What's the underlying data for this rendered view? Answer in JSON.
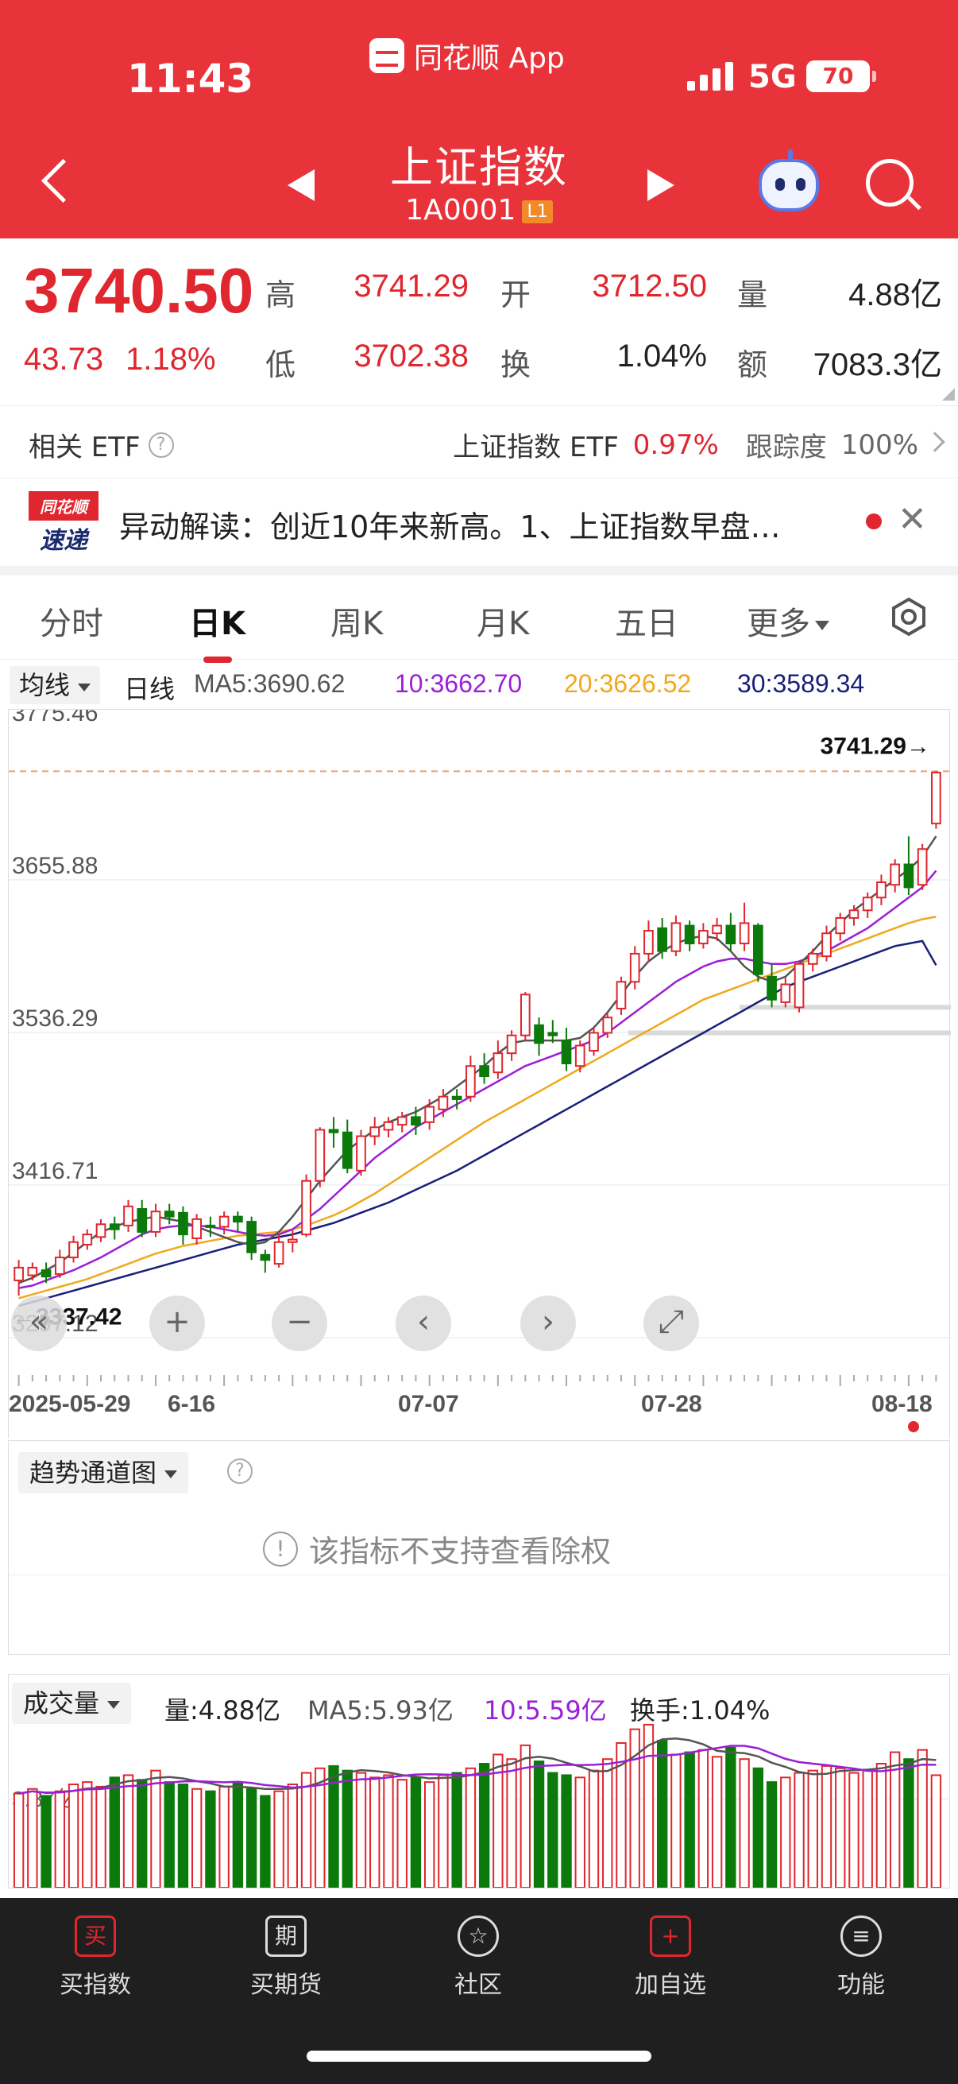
{
  "status": {
    "time": "11:43",
    "app_name": "同花顺 App",
    "network": "5G",
    "battery": "70"
  },
  "header": {
    "title": "上证指数",
    "code": "1A0001",
    "level_badge": "L1"
  },
  "quote": {
    "price": "3740.50",
    "change": "43.73",
    "change_pct": "1.18%",
    "high_label": "高",
    "high": "3741.29",
    "low_label": "低",
    "low": "3702.38",
    "open_label": "开",
    "open": "3712.50",
    "turnover_label": "换",
    "turnover": "1.04%",
    "volume_label": "量",
    "volume": "4.88亿",
    "amount_label": "额",
    "amount": "7083.3亿"
  },
  "etf": {
    "label": "相关 ETF",
    "name": "上证指数 ETF",
    "pct": "0.97%",
    "track_label": "跟踪度",
    "track": "100%"
  },
  "news": {
    "badge_top": "同花顺",
    "badge_bottom": "速递",
    "text": "异动解读：创近10年来新高。1、上证指数早盘…"
  },
  "tabs": [
    "分时",
    "日K",
    "周K",
    "月K",
    "五日",
    "更多"
  ],
  "ma": {
    "selector": "均线",
    "period": "日线",
    "ma5": "MA5:3690.62",
    "ma10": "10:3662.70",
    "ma20": "20:3626.52",
    "ma30": "30:3589.34",
    "colors": {
      "ma5": "#555555",
      "ma10": "#9b1fd6",
      "ma20": "#f0a81c",
      "ma30": "#1a1f7a"
    }
  },
  "chart_data": {
    "type": "candlestick",
    "y_labels": [
      "3775.46",
      "3655.88",
      "3536.29",
      "3416.71",
      "3297.12"
    ],
    "ylim": [
      3297.12,
      3775.46
    ],
    "high_marker": "3741.29→",
    "low_marker": "←3337.42",
    "x_labels": [
      "2025-05-29",
      "6-16",
      "07-07",
      "07-28",
      "08-18"
    ],
    "candles": [
      [
        3342,
        3352,
        3330,
        3358
      ],
      [
        3346,
        3352,
        3342,
        3356
      ],
      [
        3350,
        3345,
        3340,
        3356
      ],
      [
        3347,
        3360,
        3344,
        3366
      ],
      [
        3360,
        3372,
        3356,
        3377
      ],
      [
        3370,
        3378,
        3366,
        3382
      ],
      [
        3376,
        3386,
        3372,
        3390
      ],
      [
        3386,
        3382,
        3374,
        3392
      ],
      [
        3385,
        3400,
        3380,
        3405
      ],
      [
        3398,
        3380,
        3376,
        3405
      ],
      [
        3380,
        3396,
        3376,
        3402
      ],
      [
        3396,
        3392,
        3386,
        3402
      ],
      [
        3395,
        3378,
        3370,
        3400
      ],
      [
        3375,
        3390,
        3370,
        3394
      ],
      [
        3385,
        3384,
        3376,
        3392
      ],
      [
        3384,
        3392,
        3378,
        3396
      ],
      [
        3392,
        3388,
        3380,
        3396
      ],
      [
        3388,
        3364,
        3358,
        3392
      ],
      [
        3362,
        3358,
        3348,
        3366
      ],
      [
        3355,
        3372,
        3352,
        3378
      ],
      [
        3372,
        3374,
        3364,
        3382
      ],
      [
        3378,
        3420,
        3376,
        3425
      ],
      [
        3420,
        3460,
        3415,
        3462
      ],
      [
        3460,
        3458,
        3446,
        3470
      ],
      [
        3458,
        3430,
        3426,
        3468
      ],
      [
        3428,
        3455,
        3424,
        3460
      ],
      [
        3455,
        3462,
        3448,
        3470
      ],
      [
        3460,
        3466,
        3454,
        3470
      ],
      [
        3464,
        3470,
        3458,
        3474
      ],
      [
        3470,
        3464,
        3456,
        3478
      ],
      [
        3466,
        3478,
        3460,
        3484
      ],
      [
        3476,
        3486,
        3470,
        3492
      ],
      [
        3486,
        3484,
        3476,
        3492
      ],
      [
        3486,
        3510,
        3482,
        3518
      ],
      [
        3510,
        3502,
        3496,
        3520
      ],
      [
        3505,
        3520,
        3500,
        3530
      ],
      [
        3520,
        3534,
        3514,
        3538
      ],
      [
        3534,
        3566,
        3530,
        3568
      ],
      [
        3542,
        3528,
        3518,
        3548
      ],
      [
        3536,
        3534,
        3528,
        3546
      ],
      [
        3530,
        3512,
        3506,
        3540
      ],
      [
        3510,
        3526,
        3505,
        3530
      ],
      [
        3522,
        3536,
        3518,
        3540
      ],
      [
        3536,
        3548,
        3532,
        3552
      ],
      [
        3555,
        3576,
        3550,
        3580
      ],
      [
        3576,
        3598,
        3570,
        3604
      ],
      [
        3598,
        3616,
        3592,
        3624
      ],
      [
        3618,
        3600,
        3594,
        3626
      ],
      [
        3600,
        3622,
        3596,
        3628
      ],
      [
        3620,
        3606,
        3600,
        3624
      ],
      [
        3606,
        3616,
        3602,
        3622
      ],
      [
        3614,
        3620,
        3608,
        3626
      ],
      [
        3620,
        3606,
        3600,
        3630
      ],
      [
        3606,
        3622,
        3600,
        3638
      ],
      [
        3620,
        3582,
        3576,
        3622
      ],
      [
        3580,
        3562,
        3556,
        3590
      ],
      [
        3560,
        3574,
        3556,
        3580
      ],
      [
        3556,
        3590,
        3552,
        3592
      ],
      [
        3590,
        3598,
        3584,
        3602
      ],
      [
        3596,
        3614,
        3592,
        3620
      ],
      [
        3614,
        3626,
        3608,
        3630
      ],
      [
        3626,
        3632,
        3620,
        3636
      ],
      [
        3632,
        3642,
        3626,
        3646
      ],
      [
        3642,
        3654,
        3636,
        3660
      ],
      [
        3652,
        3668,
        3646,
        3672
      ],
      [
        3668,
        3650,
        3644,
        3690
      ],
      [
        3652,
        3680,
        3648,
        3684
      ],
      [
        3700,
        3740,
        3696,
        3741
      ]
    ],
    "ma5": [
      3340,
      3344,
      3350,
      3356,
      3364,
      3372,
      3380,
      3384,
      3388,
      3390,
      3392,
      3390,
      3388,
      3384,
      3380,
      3376,
      3372,
      3370,
      3372,
      3380,
      3392,
      3406,
      3420,
      3432,
      3444,
      3452,
      3460,
      3466,
      3470,
      3474,
      3480,
      3486,
      3494,
      3502,
      3510,
      3520,
      3528,
      3530,
      3530,
      3530,
      3530,
      3532,
      3540,
      3552,
      3566,
      3580,
      3592,
      3600,
      3606,
      3610,
      3612,
      3610,
      3600,
      3588,
      3580,
      3576,
      3580,
      3590,
      3600,
      3612,
      3622,
      3632,
      3640,
      3648,
      3656,
      3664,
      3674,
      3690
    ],
    "ma10": [
      3336,
      3338,
      3342,
      3346,
      3350,
      3355,
      3360,
      3366,
      3372,
      3378,
      3382,
      3384,
      3385,
      3385,
      3384,
      3382,
      3380,
      3378,
      3377,
      3378,
      3382,
      3390,
      3398,
      3408,
      3418,
      3428,
      3438,
      3446,
      3454,
      3462,
      3468,
      3474,
      3480,
      3486,
      3492,
      3498,
      3504,
      3510,
      3514,
      3518,
      3522,
      3526,
      3530,
      3536,
      3544,
      3552,
      3560,
      3568,
      3576,
      3582,
      3588,
      3592,
      3594,
      3594,
      3592,
      3590,
      3590,
      3592,
      3596,
      3600,
      3606,
      3612,
      3618,
      3626,
      3634,
      3642,
      3650,
      3663
    ],
    "ma20": [
      3328,
      3331,
      3334,
      3337,
      3340,
      3343,
      3347,
      3351,
      3355,
      3359,
      3363,
      3366,
      3369,
      3371,
      3373,
      3375,
      3377,
      3378,
      3379,
      3380,
      3382,
      3385,
      3389,
      3393,
      3398,
      3404,
      3410,
      3417,
      3424,
      3431,
      3438,
      3445,
      3452,
      3459,
      3466,
      3472,
      3478,
      3484,
      3490,
      3496,
      3502,
      3508,
      3514,
      3520,
      3526,
      3532,
      3538,
      3544,
      3550,
      3556,
      3562,
      3566,
      3570,
      3574,
      3578,
      3582,
      3586,
      3590,
      3594,
      3598,
      3602,
      3606,
      3610,
      3614,
      3618,
      3622,
      3625,
      3627
    ],
    "ma30": [
      3322,
      3325,
      3328,
      3331,
      3334,
      3337,
      3340,
      3343,
      3346,
      3349,
      3352,
      3355,
      3358,
      3361,
      3364,
      3367,
      3370,
      3372,
      3374,
      3376,
      3378,
      3381,
      3384,
      3387,
      3391,
      3395,
      3399,
      3403,
      3408,
      3413,
      3418,
      3423,
      3428,
      3434,
      3440,
      3446,
      3452,
      3458,
      3464,
      3470,
      3476,
      3482,
      3488,
      3494,
      3500,
      3506,
      3512,
      3518,
      3524,
      3530,
      3536,
      3542,
      3548,
      3554,
      3560,
      3566,
      3572,
      3576,
      3580,
      3584,
      3588,
      3592,
      3596,
      3600,
      3604,
      3606,
      3608,
      3589
    ]
  },
  "controls": [
    "«",
    "+",
    "−",
    "‹",
    "›",
    "⤢"
  ],
  "trend": {
    "selector": "趋势通道图",
    "message": "该指标不支持查看除权"
  },
  "volume": {
    "selector": "成交量",
    "vol": "量:4.88亿",
    "ma5": "MA5:5.93亿",
    "ma10": "10:5.59亿",
    "turnover": "换手:1.04%",
    "axis_label": "3.87亿",
    "bars": [
      4.1,
      4.3,
      4.0,
      4.2,
      4.5,
      4.6,
      4.4,
      4.8,
      4.9,
      4.7,
      5.1,
      4.6,
      4.5,
      4.3,
      4.2,
      4.4,
      4.6,
      4.3,
      4.0,
      4.2,
      4.5,
      5.0,
      5.2,
      5.3,
      5.1,
      5.0,
      4.8,
      4.9,
      4.7,
      4.8,
      4.6,
      4.9,
      5.0,
      5.2,
      5.4,
      5.8,
      5.6,
      6.2,
      5.5,
      5.0,
      4.9,
      4.8,
      5.1,
      5.6,
      6.3,
      6.9,
      7.1,
      6.4,
      5.8,
      5.9,
      6.0,
      5.7,
      6.1,
      5.6,
      5.2,
      4.6,
      4.8,
      5.0,
      5.1,
      5.3,
      5.2,
      5.0,
      5.1,
      5.4,
      5.9,
      5.6,
      6.0,
      4.9
    ],
    "max": 7.2
  },
  "bottom_nav": [
    {
      "label": "买指数",
      "icon": "买"
    },
    {
      "label": "买期货",
      "icon": "期"
    },
    {
      "label": "社区",
      "icon": "☆"
    },
    {
      "label": "加自选",
      "icon": "+"
    },
    {
      "label": "功能",
      "icon": "≡"
    }
  ]
}
